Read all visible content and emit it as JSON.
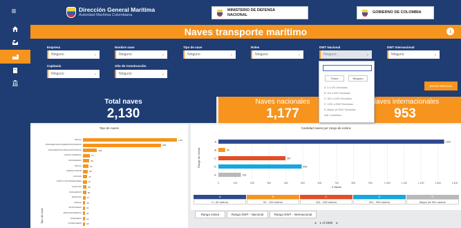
{
  "colors": {
    "navy": "#1f3d73",
    "orange": "#f7941d",
    "red": "#e14f26",
    "cyan": "#16a7e0",
    "gray": "#b9b9b9",
    "blue": "#2e4a8f"
  },
  "sidebar": {
    "menu_icon": "hamburger-icon",
    "items": [
      {
        "icon": "home-icon"
      },
      {
        "icon": "ship-icon"
      },
      {
        "icon": "factory-icon",
        "active": true
      },
      {
        "icon": "building-icon"
      },
      {
        "icon": "bank-icon"
      }
    ]
  },
  "header": {
    "dgm_title": "Dirección General Marítima",
    "dgm_subtitle": "Autoridad Marítima Colombiana",
    "ministry_line1": "MINISTERIO DE DEFENSA",
    "ministry_line2": "NACIONAL",
    "gov": "GOBIERNO DE COLOMBIA"
  },
  "page": {
    "title": "Naves transporte marítimo",
    "info_icon": "i"
  },
  "filters": [
    {
      "label": "Empresa",
      "value": "Ninguno"
    },
    {
      "label": "Nombre nave",
      "value": "Ninguno"
    },
    {
      "label": "Tipo de nave",
      "value": "Ninguno"
    },
    {
      "label": "Roles",
      "value": "Ninguno"
    },
    {
      "label": "DWT Nacional",
      "value": "Ninguno"
    },
    {
      "label": "DWT Internacional",
      "value": "Ninguno"
    },
    {
      "label": "Capitanía",
      "value": "Ninguno"
    },
    {
      "label": "Año de Construcción",
      "value": "Ninguno"
    }
  ],
  "dropdown": {
    "all_label": "Todos",
    "none_label": "Ninguno",
    "options": [
      "A. 0 a 100 Toneladas",
      "B. 101 a 500 Toneladas",
      "C. 501 a 1000 Toneladas",
      "D. 1001 a 5000 Toneladas",
      "E. Mayor de 5000 Toneladas",
      "Null. Undefined"
    ]
  },
  "clear_button": "Borrar selección",
  "kpis": [
    {
      "label": "Total naves",
      "value": "2,130"
    },
    {
      "label": "Naves nacionales",
      "value": "1,177"
    },
    {
      "label": "Naves internacionales",
      "value": "953"
    }
  ],
  "chart_data": [
    {
      "type": "bar",
      "title": "Tipo de naves",
      "ylabel": "Tipo de nave",
      "categories": [
        "PESCA",
        "PASAJEROS/ACARREO/ASISTENCIA",
        "PASAJEROS/CARGA/ASISTENCIA",
        "CARGA GENERAL",
        "GRANELERO",
        "BALSA",
        "REMOLCADOR",
        "LANCHA",
        "PORTA CONTENEDORES",
        "CHALUPA",
        "PASAJEROS",
        "BARCAZA",
        "DRAGA",
        "PETROLERO",
        "ABASTECIMIENTO",
        "TANQUERO",
        "QUIMIQUERO"
      ],
      "values": [
        1000,
        833,
        149,
        73,
        69,
        61,
        53,
        47,
        41,
        38,
        35,
        27,
        25,
        22,
        21,
        19,
        18
      ],
      "value_labels": [
        "1.0K",
        "833",
        "149",
        "73",
        "69",
        "61",
        "53",
        "47",
        "41",
        "38",
        "35",
        "27",
        "25",
        "22",
        "21",
        "19",
        "18"
      ]
    },
    {
      "type": "bar",
      "title": "Cantidad naves por rango de eslora",
      "xlabel": "# Naves",
      "ylabel": "Rango de eslora",
      "categories": [
        "A",
        "B",
        "C",
        "D",
        "E"
      ],
      "values": [
        1337,
        40,
        397,
        493,
        133
      ],
      "colors": [
        "#2e4a8f",
        "#f7941d",
        "#e14f26",
        "#16a7e0",
        "#b9b9b9"
      ],
      "xticks": [
        "0",
        "100",
        "200",
        "300",
        "400",
        "500",
        "600",
        "700",
        "800",
        "900",
        "1.000",
        "1.100",
        "1.200",
        "1.300",
        "1.400"
      ],
      "xlim": [
        0,
        1400
      ]
    }
  ],
  "eslora_legend": [
    {
      "code": "A",
      "range": "0 - 50 metros"
    },
    {
      "code": "B",
      "range": "51 - 100 metros"
    },
    {
      "code": "C",
      "range": "101 - 200 metros"
    },
    {
      "code": "D",
      "range": "201 - 300 metros"
    },
    {
      "code": "E",
      "range": "Mayor de 301 metros"
    }
  ],
  "tabs": [
    "Rango eslora",
    "Rango DWT - Nacional",
    "Rango DWT - Internacional"
  ],
  "pager": {
    "prev": "◂",
    "text": "1 of 2080",
    "next": "▸"
  }
}
